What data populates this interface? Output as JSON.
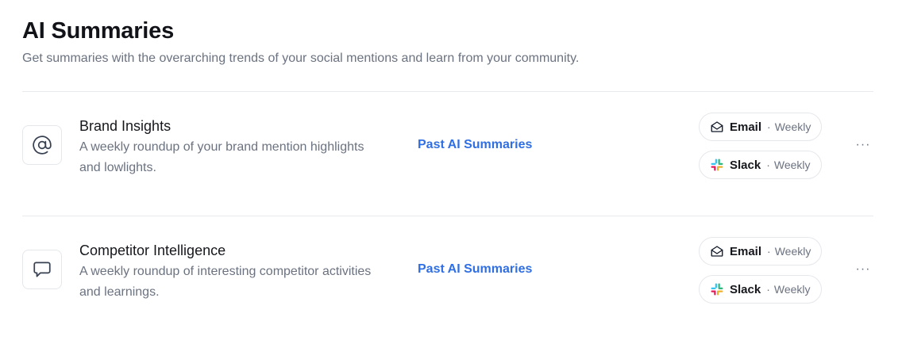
{
  "page": {
    "title": "AI Summaries",
    "subtitle": "Get summaries with the overarching trends of your social mentions and learn from your community."
  },
  "summaries": [
    {
      "icon": "at-sign-icon",
      "title": "Brand Insights",
      "description": "A weekly roundup of your brand mention highlights and lowlights.",
      "link_label": "Past AI Summaries",
      "channels": [
        {
          "icon": "envelope-open-icon",
          "name": "Email",
          "separator": "·",
          "frequency": "Weekly"
        },
        {
          "icon": "slack-logo-icon",
          "name": "Slack",
          "separator": "·",
          "frequency": "Weekly"
        }
      ],
      "more_label": "···"
    },
    {
      "icon": "speech-bubble-icon",
      "title": "Competitor Intelligence",
      "description": "A weekly roundup of interesting competitor activities and learnings.",
      "link_label": "Past AI Summaries",
      "channels": [
        {
          "icon": "envelope-open-icon",
          "name": "Email",
          "separator": "·",
          "frequency": "Weekly"
        },
        {
          "icon": "slack-logo-icon",
          "name": "Slack",
          "separator": "·",
          "frequency": "Weekly"
        }
      ],
      "more_label": "···"
    }
  ],
  "colors": {
    "link": "#2f6fe4",
    "muted_text": "#6b7280",
    "border": "#e5e7eb",
    "slack_blue": "#36c5f0",
    "slack_green": "#2eb67d",
    "slack_yellow": "#ecb22e",
    "slack_red": "#e01e5a"
  }
}
